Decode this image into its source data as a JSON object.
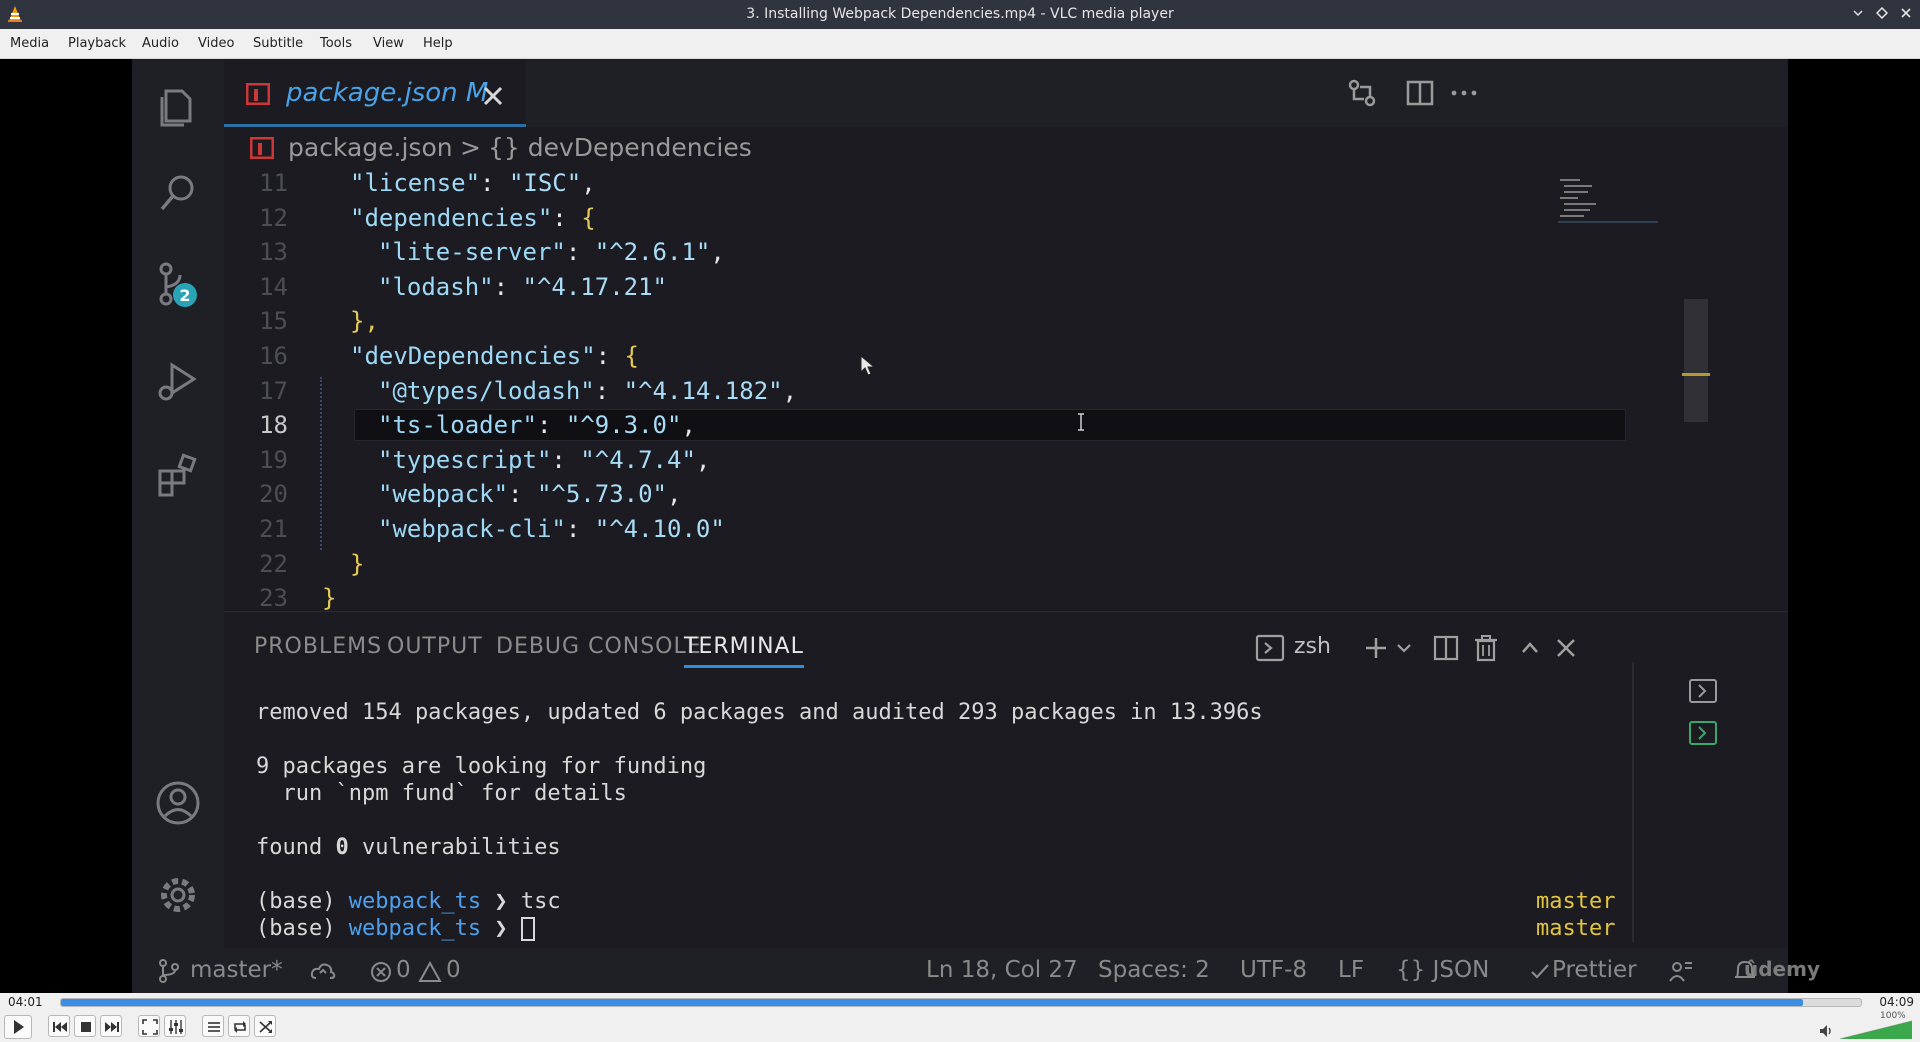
{
  "window": {
    "title": "3. Installing Webpack Dependencies.mp4 - VLC media player"
  },
  "menu": [
    "Media",
    "Playback",
    "Audio",
    "Video",
    "Subtitle",
    "Tools",
    "View",
    "Help"
  ],
  "vscode": {
    "tab": {
      "label": "package.json M"
    },
    "breadcrumb": {
      "file": "package.json",
      "sep": ">",
      "symbol": "{} devDependencies"
    },
    "scm_badge": "2",
    "editor": {
      "line_numbers": [
        "11",
        "12",
        "13",
        "14",
        "15",
        "16",
        "17",
        "18",
        "19",
        "20",
        "21",
        "22",
        "23"
      ],
      "current_line": "18",
      "lines": [
        {
          "indent": 1,
          "key": "\"license\"",
          "rest": ": ",
          "value": "\"ISC\"",
          "tail": ","
        },
        {
          "indent": 1,
          "key": "\"dependencies\"",
          "rest": ": ",
          "value": "",
          "tail": "{"
        },
        {
          "indent": 2,
          "key": "\"lite-server\"",
          "rest": ": ",
          "value": "\"^2.6.1\"",
          "tail": ","
        },
        {
          "indent": 2,
          "key": "\"lodash\"",
          "rest": ": ",
          "value": "\"^4.17.21\"",
          "tail": ""
        },
        {
          "indent": 1,
          "key": "",
          "rest": "",
          "value": "",
          "tail": "},"
        },
        {
          "indent": 1,
          "key": "\"devDependencies\"",
          "rest": ": ",
          "value": "",
          "tail": "{"
        },
        {
          "indent": 2,
          "key": "\"@types/lodash\"",
          "rest": ": ",
          "value": "\"^4.14.182\"",
          "tail": ","
        },
        {
          "indent": 2,
          "key": "\"ts-loader\"",
          "rest": ": ",
          "value": "\"^9.3.0\"",
          "tail": ","
        },
        {
          "indent": 2,
          "key": "\"typescript\"",
          "rest": ": ",
          "value": "\"^4.7.4\"",
          "tail": ","
        },
        {
          "indent": 2,
          "key": "\"webpack\"",
          "rest": ": ",
          "value": "\"^5.73.0\"",
          "tail": ","
        },
        {
          "indent": 2,
          "key": "\"webpack-cli\"",
          "rest": ": ",
          "value": "\"^4.10.0\"",
          "tail": ""
        },
        {
          "indent": 1,
          "key": "",
          "rest": "",
          "value": "",
          "tail": "}"
        },
        {
          "indent": 0,
          "key": "",
          "rest": "",
          "value": "",
          "tail": "}"
        }
      ]
    },
    "panel": {
      "tabs": [
        "PROBLEMS",
        "OUTPUT",
        "DEBUG CONSOLE",
        "TERMINAL"
      ],
      "active_tab": "TERMINAL",
      "shell": "zsh"
    },
    "terminal": {
      "line1": "removed 154 packages, updated 6 packages and audited 293 packages in 13.396s",
      "line2": "9 packages are looking for funding",
      "line3": "  run `npm fund` for details",
      "line4_pre": "found ",
      "line4_num": "0",
      "line4_post": " vulnerabilities",
      "prompt_base": "(base) ",
      "prompt_dir": "webpack_ts",
      "prompt_arrow": " ❯ ",
      "cmd1": "tsc",
      "branch1": "master",
      "branch2": "master"
    },
    "status": {
      "branch": "master*",
      "errors": "0",
      "warnings": "0",
      "position": "Ln 18, Col 27",
      "spaces": "Spaces: 2",
      "encoding": "UTF-8",
      "eol": "LF",
      "language": "{} JSON",
      "formatter": "Prettier"
    },
    "watermark": "ûdemy"
  },
  "player": {
    "elapsed": "04:01",
    "total": "04:09",
    "progress": 0.968,
    "volume_label": "100%",
    "volume": 1.0
  },
  "colors": {
    "accent": "#3b8ee6",
    "vscode_bg": "#1b1b21",
    "string": "#a9dcf7",
    "terminal_blue": "#4ea0ec",
    "branch_yellow": "#e2c541"
  }
}
